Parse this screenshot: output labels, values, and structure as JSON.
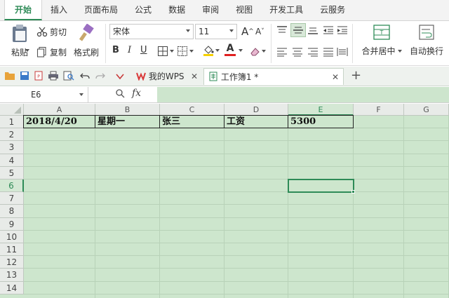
{
  "menu": {
    "tabs": [
      "开始",
      "插入",
      "页面布局",
      "公式",
      "数据",
      "审阅",
      "视图",
      "开发工具",
      "云服务"
    ],
    "active_index": 0
  },
  "ribbon": {
    "paste_label": "粘贴",
    "cut_label": "剪切",
    "copy_label": "复制",
    "format_painter_label": "格式刷",
    "font_name": "宋体",
    "font_size": "11",
    "bold": "B",
    "italic": "I",
    "underline": "U",
    "grow_font": "A",
    "shrink_font": "A",
    "font_color_glyph": "A",
    "merge_center_label": "合并居中",
    "wrap_text_label": "自动换行",
    "accent_color": "#2e8b57"
  },
  "doc_tabs": [
    {
      "label": "我的WPS",
      "active": false
    },
    {
      "label": "工作簿1 *",
      "active": true
    }
  ],
  "add_tab_glyph": "+",
  "formula_bar": {
    "name_box": "E6",
    "fx_label": "fx",
    "content": ""
  },
  "grid": {
    "columns": [
      "A",
      "B",
      "C",
      "D",
      "E",
      "F",
      "G"
    ],
    "rows": [
      "1",
      "2",
      "3",
      "4",
      "5",
      "6",
      "7",
      "8",
      "9",
      "10",
      "11",
      "12",
      "13",
      "14"
    ],
    "active_cell": "E6",
    "cells": {
      "A1": "2018/4/20",
      "B1": "星期一",
      "C1": "张三",
      "D1": "工资",
      "E1": "5300"
    }
  }
}
